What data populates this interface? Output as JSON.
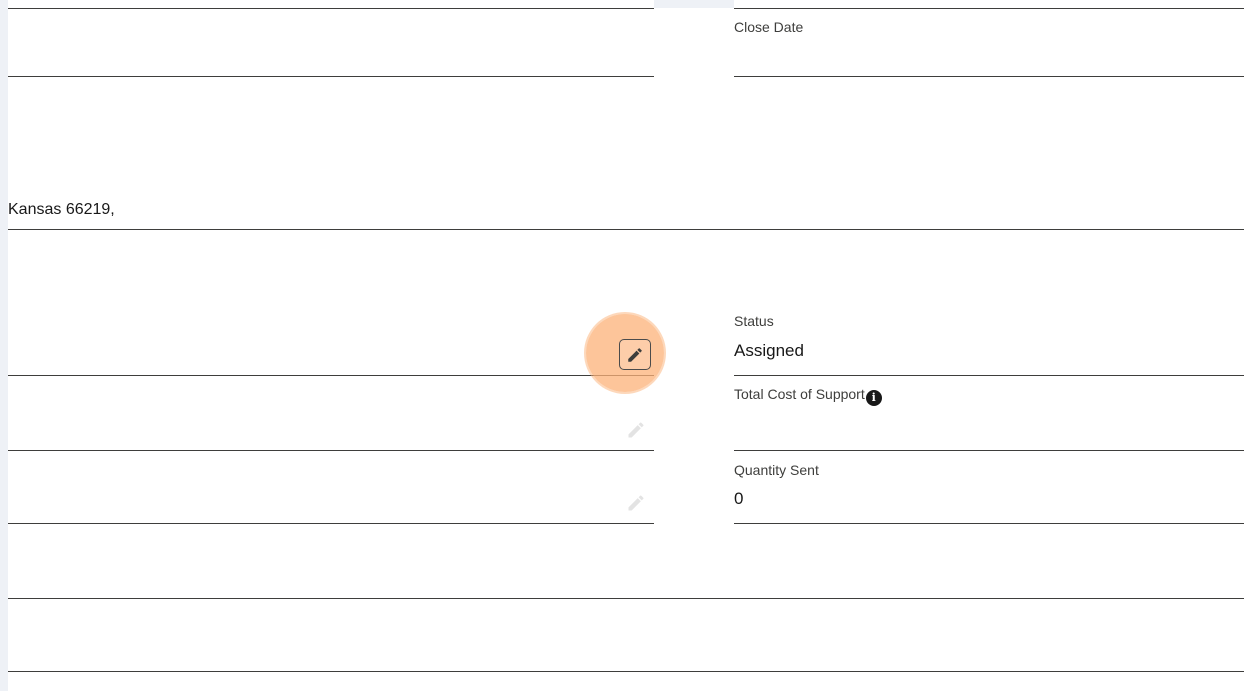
{
  "address": {
    "line": "Kansas 66219,"
  },
  "fields": {
    "close_date": {
      "label": "Close Date",
      "value": ""
    },
    "status": {
      "label": "Status",
      "value": "Assigned"
    },
    "total_cost": {
      "label": "Total Cost of Support",
      "value": "",
      "info_icon": "info-icon"
    },
    "quantity_sent": {
      "label": "Quantity Sent",
      "value": "0"
    }
  },
  "icons": {
    "edit": "pencil-icon",
    "info": "info-icon"
  },
  "colors": {
    "highlight": "#fcb278",
    "divider": "#3e3e3c",
    "background_strip": "#eef1f6"
  }
}
